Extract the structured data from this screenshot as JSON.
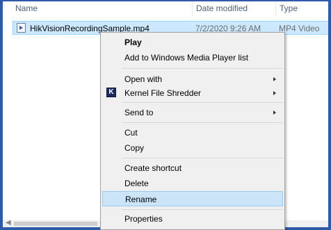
{
  "columns": {
    "name": "Name",
    "date_modified": "Date modified",
    "type": "Type"
  },
  "file": {
    "name": "HikVisionRecordingSample.mp4",
    "date_modified": "7/2/2020 9:26 AM",
    "type": "MP4 Video"
  },
  "context_menu": {
    "play": "Play",
    "add_to_wmp": "Add to Windows Media Player list",
    "open_with": "Open with",
    "kernel_file_shredder": "Kernel File Shredder",
    "kernel_icon_glyph": "K",
    "send_to": "Send to",
    "cut": "Cut",
    "copy": "Copy",
    "create_shortcut": "Create shortcut",
    "delete": "Delete",
    "rename": "Rename",
    "properties": "Properties",
    "highlighted_item": "rename"
  },
  "colors": {
    "frame": "#2e5aa8",
    "selection": "#cce8ff",
    "menu_highlight": "#cce4f7"
  }
}
